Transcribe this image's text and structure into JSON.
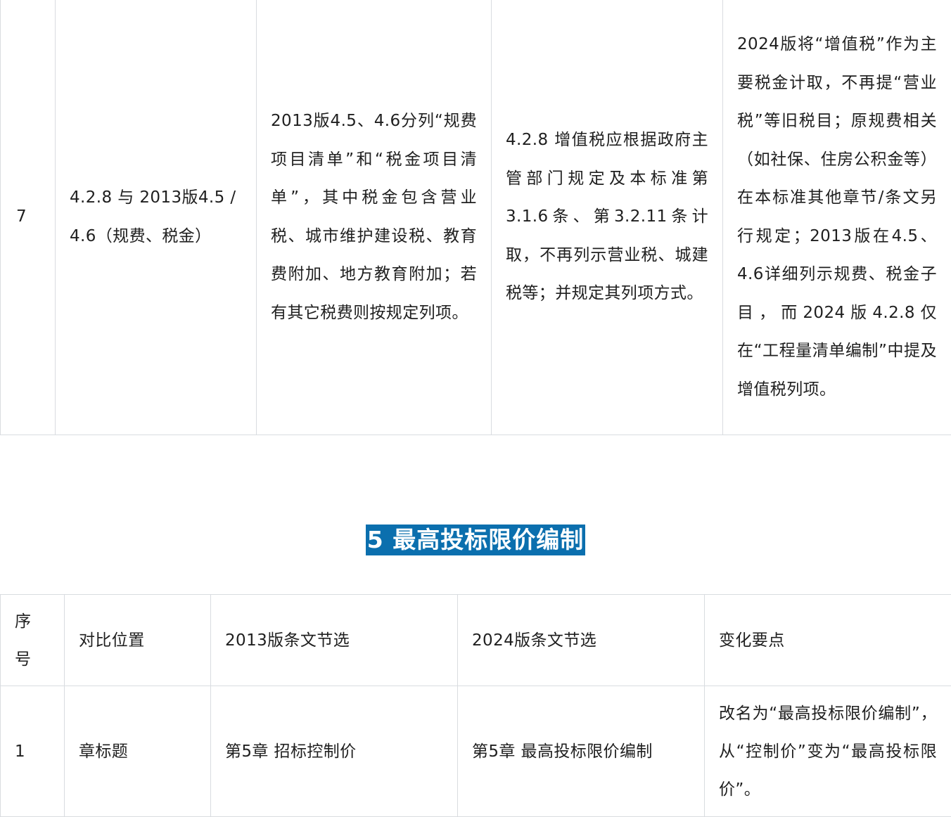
{
  "top_table": {
    "row": {
      "num": "7",
      "position": "4.2.8 与 2013版4.5 / 4.6（规费、税金）",
      "v2013": "2013版4.5、4.6分列“规费项目清单”和“税金项目清单”，其中税金包含营业税、城市维护建设税、教育费附加、地方教育附加；若有其它税费则按规定列项。",
      "v2024": "4.2.8 增值税应根据政府主管部门规定及本标准第3.1.6条、第3.2.11条计取，不再列示营业税、城建税等；并规定其列项方式。",
      "change": "2024版将“增值税”作为主要税金计取，不再提“营业税”等旧税目；原规费相关（如社保、住房公积金等）在本标准其他章节/条文另行规定；2013版在4.5、4.6详细列示规费、税金子目，而2024版4.2.8仅在“工程量清单编制”中提及增值税列项。"
    }
  },
  "section": {
    "title": "5 最高投标限价编制"
  },
  "bottom_table": {
    "headers": {
      "num": "序号",
      "position": "对比位置",
      "v2013": "2013版条文节选",
      "v2024": "2024版条文节选",
      "change": "变化要点"
    },
    "rows": [
      {
        "num": "1",
        "position": "章标题",
        "v2013": "第5章 招标控制价",
        "v2024": "第5章 最高投标限价编制",
        "change": "改名为“最高投标限价编制”，从“控制价”变为“最高投标限价”。"
      }
    ]
  }
}
